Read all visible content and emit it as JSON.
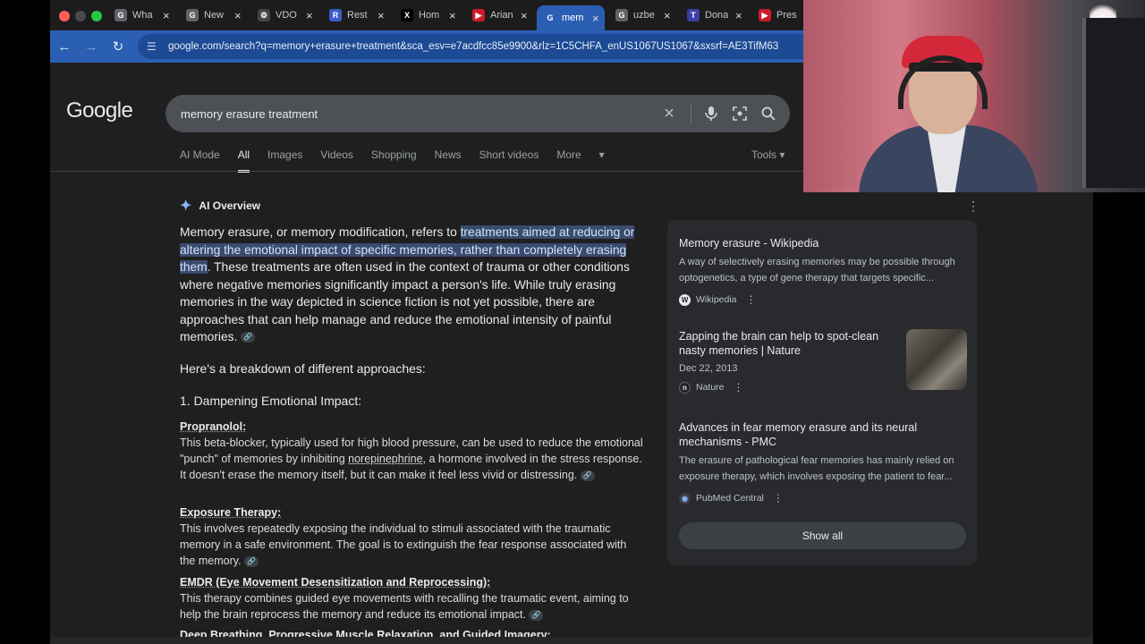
{
  "tabs": [
    {
      "label": "Wha",
      "fav_color": "#5f6368",
      "fav_glyph": "G"
    },
    {
      "label": "New",
      "fav_color": "#5f6368",
      "fav_glyph": "G"
    },
    {
      "label": "VDO",
      "fav_color": "#444444",
      "fav_glyph": "⚙"
    },
    {
      "label": "Rest",
      "fav_color": "#3b5bcc",
      "fav_glyph": "R"
    },
    {
      "label": "Hom",
      "fav_color": "#000000",
      "fav_glyph": "X"
    },
    {
      "label": "Arian",
      "fav_color": "#cc1b2c",
      "fav_glyph": "▶"
    },
    {
      "label": "mem",
      "fav_color": "#2b5fb4",
      "fav_glyph": "G",
      "active": true
    },
    {
      "label": "uzbe",
      "fav_color": "#5f6368",
      "fav_glyph": "G"
    },
    {
      "label": "Dona",
      "fav_color": "#3b3fa8",
      "fav_glyph": "T"
    },
    {
      "label": "Pres",
      "fav_color": "#cc1b2c",
      "fav_glyph": "▶"
    }
  ],
  "url": "google.com/search?q=memory+erasure+treatment&sca_esv=e7acdfcc85e9900&rlz=1C5CHFA_enUS1067US1067&sxsrf=AE3TifM63",
  "logo": "Google",
  "search": {
    "query": "memory erasure treatment"
  },
  "filters": [
    "AI Mode",
    "All",
    "Images",
    "Videos",
    "Shopping",
    "News",
    "Short videos",
    "More"
  ],
  "tools_label": "Tools",
  "ai": {
    "heading": "AI Overview",
    "intro_pre": "Memory erasure, or memory modification, refers to ",
    "intro_highlight": "treatments aimed at reducing or altering the emotional impact of specific memories, rather than completely erasing them",
    "intro_post": ". These treatments are often used in the context of trauma or other conditions where negative memories significantly impact a person's life. While truly erasing memories in the way depicted in science fiction is not yet possible, there are approaches that can help manage and reduce the emotional intensity of painful memories.",
    "breakdown": "Here's a breakdown of different approaches:",
    "section1": "1. Dampening Emotional Impact:",
    "items": [
      {
        "title": "Propranolol:",
        "text_pre": "This beta-blocker, typically used for high blood pressure, can be used to reduce the emotional \"punch\" of memories by inhibiting ",
        "text_link": "norepinephrine",
        "text_post": ", a hormone involved in the stress response. It doesn't erase the memory itself, but it can make it feel less vivid or distressing."
      },
      {
        "title": "Exposure Therapy:",
        "text": "This involves repeatedly exposing the individual to stimuli associated with the traumatic memory in a safe environment. The goal is to extinguish the fear response associated with the memory."
      },
      {
        "title": "EMDR (Eye Movement Desensitization and Reprocessing):",
        "text": "This therapy combines guided eye movements with recalling the traumatic event, aiming to help the brain reprocess the memory and reduce its emotional impact."
      },
      {
        "title": "Deep Breathing, Progressive Muscle Relaxation, and Guided Imagery:"
      }
    ]
  },
  "sources": [
    {
      "title": "Memory erasure - Wikipedia",
      "desc": "A way of selectively erasing memories may be possible through optogenetics, a type of gene therapy that targets specific...",
      "site": "Wikipedia",
      "fav": "W"
    },
    {
      "title": "Zapping the brain can help to spot-clean nasty memories | Nature",
      "date": "Dec 22, 2013",
      "site": "Nature",
      "fav": "n"
    },
    {
      "title": "Advances in fear memory erasure and its neural mechanisms - PMC",
      "desc": "The erasure of pathological fear memories has mainly relied on exposure therapy, which involves exposing the patient to fear...",
      "site": "PubMed Central",
      "fav": "◉"
    }
  ],
  "show_all": "Show all"
}
